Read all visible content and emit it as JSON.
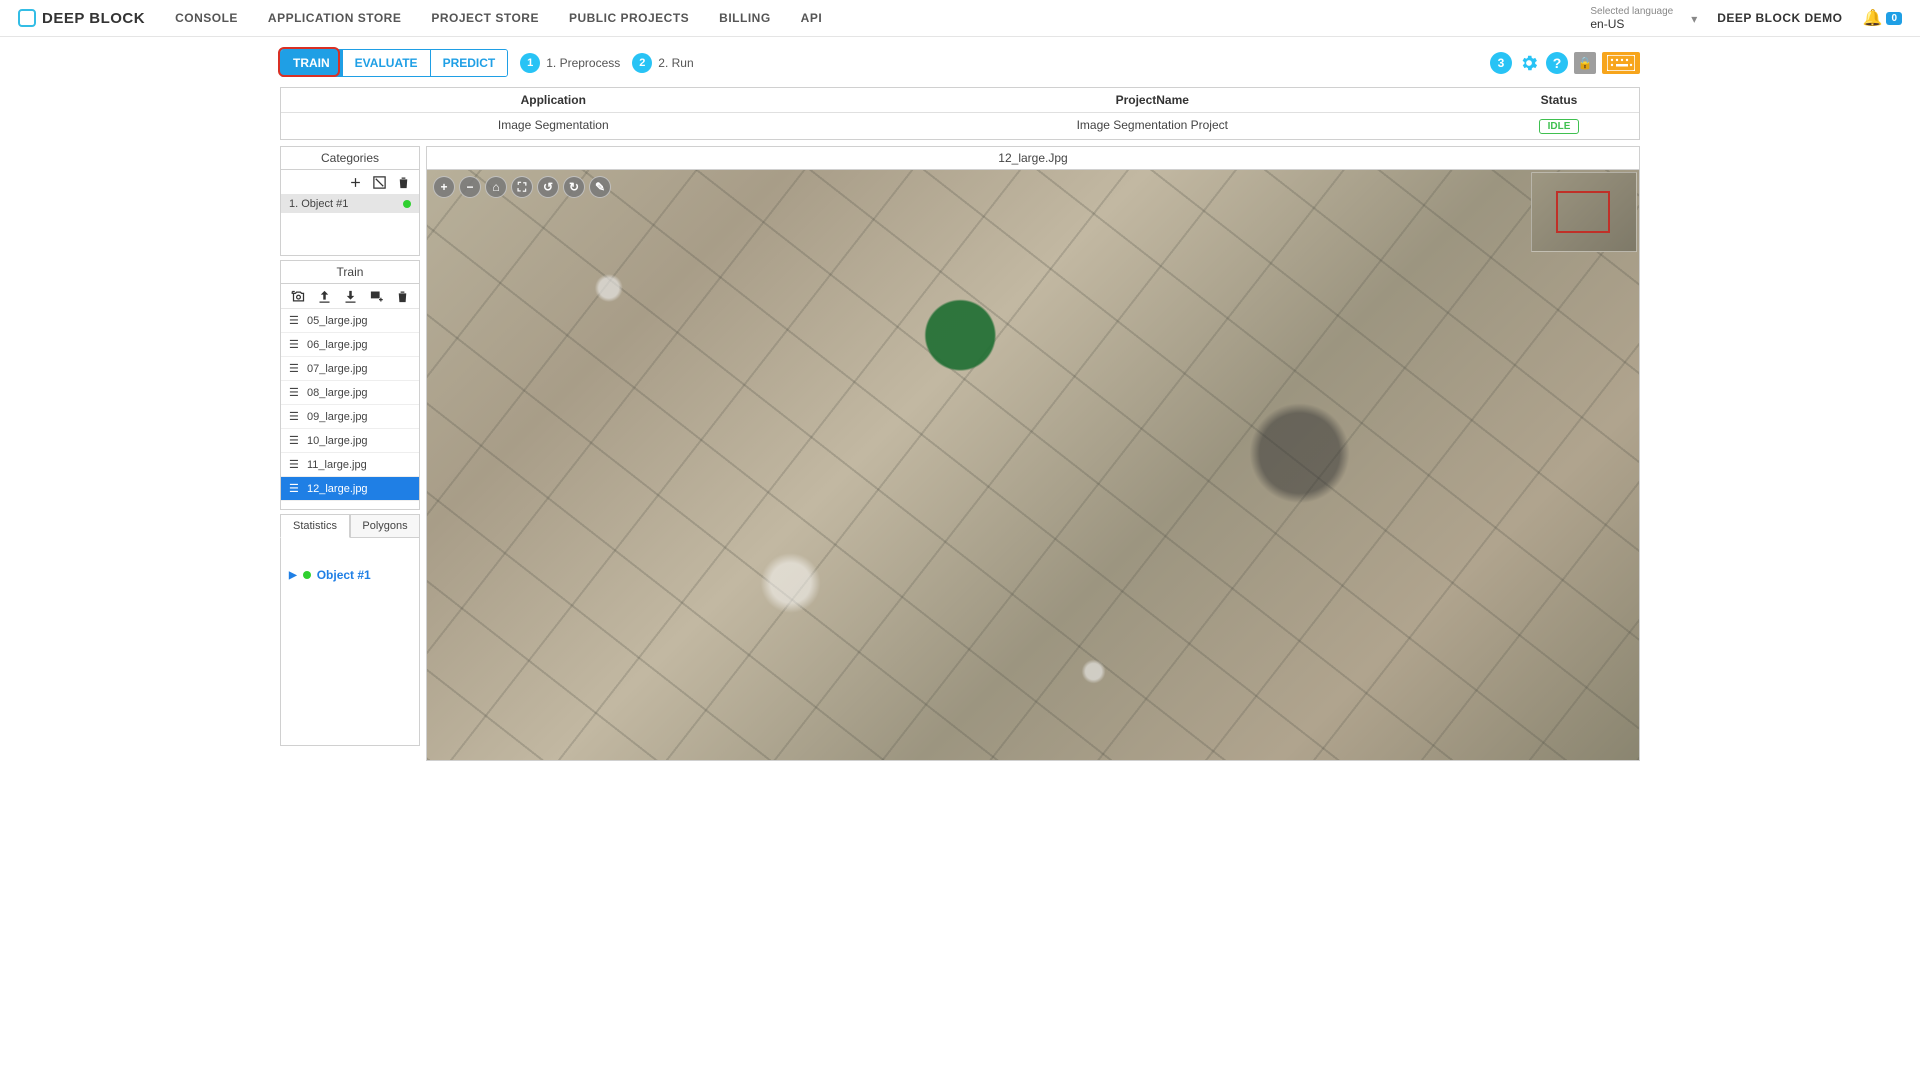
{
  "header": {
    "logo_text": "DEEP BLOCK",
    "nav": [
      "CONSOLE",
      "APPLICATION STORE",
      "PROJECT STORE",
      "PUBLIC PROJECTS",
      "BILLING",
      "API"
    ],
    "lang_label": "Selected language",
    "lang_value": "en-US",
    "user": "DEEP BLOCK DEMO",
    "notif_count": "0"
  },
  "toolbar": {
    "modes": [
      "TRAIN",
      "EVALUATE",
      "PREDICT"
    ],
    "active_mode": 0,
    "steps": [
      {
        "num": "1",
        "label": "1. Preprocess"
      },
      {
        "num": "2",
        "label": "2. Run"
      }
    ],
    "right_badge": "3"
  },
  "project": {
    "headers": [
      "Application",
      "ProjectName",
      "Status"
    ],
    "row": {
      "application": "Image Segmentation",
      "name": "Image Segmentation Project",
      "status": "IDLE"
    }
  },
  "categories": {
    "title": "Categories",
    "items": [
      {
        "label": "1. Object #1"
      }
    ]
  },
  "train": {
    "title": "Train",
    "files": [
      "05_large.jpg",
      "06_large.jpg",
      "07_large.jpg",
      "08_large.jpg",
      "09_large.jpg",
      "10_large.jpg",
      "11_large.jpg",
      "12_large.jpg"
    ],
    "selected": "12_large.jpg"
  },
  "tabs": {
    "items": [
      "Statistics",
      "Polygons"
    ],
    "active": 0
  },
  "stats": {
    "object_label": "Object #1"
  },
  "viewer": {
    "title": "12_large.Jpg",
    "tools": [
      "+",
      "−",
      "⌂",
      "⛶",
      "↺",
      "↻",
      "✎"
    ]
  }
}
